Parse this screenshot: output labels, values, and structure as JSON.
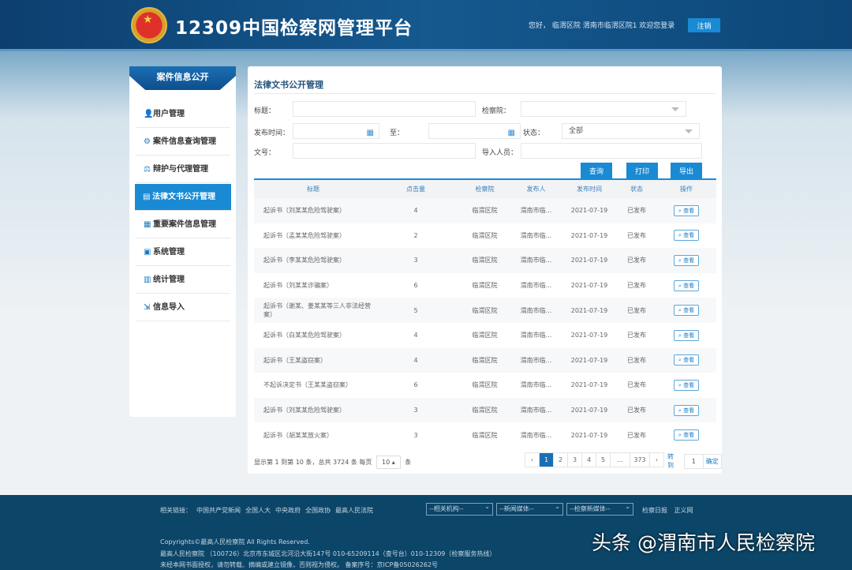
{
  "header": {
    "title": "12309中国检察网管理平台",
    "greeting": "您好， 临渭区院  渭南市临渭区院1  欢迎您登录",
    "logout": "注销"
  },
  "sidebar": {
    "title": "案件信息公开",
    "items": [
      {
        "label": "用户管理",
        "icon": "user-icon",
        "glyph": "👤"
      },
      {
        "label": "案件信息查询管理",
        "icon": "case-query-icon",
        "glyph": "⚙"
      },
      {
        "label": "辩护与代理管理",
        "icon": "defense-icon",
        "glyph": "⚖"
      },
      {
        "label": "法律文书公开管理",
        "icon": "book-icon",
        "glyph": "▤"
      },
      {
        "label": "重要案件信息管理",
        "icon": "important-case-icon",
        "glyph": "▦"
      },
      {
        "label": "系统管理",
        "icon": "system-icon",
        "glyph": "▣"
      },
      {
        "label": "统计管理",
        "icon": "stats-icon",
        "glyph": "▥"
      },
      {
        "label": "信息导入",
        "icon": "import-icon",
        "glyph": "⇲"
      }
    ],
    "active": 3
  },
  "main": {
    "title": "法律文书公开管理",
    "filters": {
      "title_label": "标题：",
      "procuratorate_label": "检察院：",
      "publish_time_label": "发布时间：",
      "to_label": "至：",
      "status_label": "状态：",
      "status_value": "全部",
      "doc_no_label": "文号：",
      "importer_label": "导入人员："
    },
    "buttons": {
      "query": "查询",
      "print": "打印",
      "export": "导出"
    },
    "columns": [
      "标题",
      "点击量",
      "检察院",
      "发布人",
      "发布时间",
      "状态",
      "操作"
    ],
    "view_label": "查看",
    "rows": [
      [
        "起诉书（刘某某危险驾驶案）",
        "4",
        "临渭区院",
        "渭南市临...",
        "2021-07-19",
        "已发布"
      ],
      [
        "起诉书（孟某某危险驾驶案）",
        "2",
        "临渭区院",
        "渭南市临...",
        "2021-07-19",
        "已发布"
      ],
      [
        "起诉书（李某某危险驾驶案）",
        "3",
        "临渭区院",
        "渭南市临...",
        "2021-07-19",
        "已发布"
      ],
      [
        "起诉书（刘某某诈骗案）",
        "6",
        "临渭区院",
        "渭南市临...",
        "2021-07-19",
        "已发布"
      ],
      [
        "起诉书（谢某、姜某某等三人非法经营案）",
        "5",
        "临渭区院",
        "渭南市临...",
        "2021-07-19",
        "已发布"
      ],
      [
        "起诉书（白某某危险驾驶案）",
        "4",
        "临渭区院",
        "渭南市临...",
        "2021-07-19",
        "已发布"
      ],
      [
        "起诉书（王某盗窃案）",
        "4",
        "临渭区院",
        "渭南市临...",
        "2021-07-19",
        "已发布"
      ],
      [
        "不起诉决定书（王某某盗窃案）",
        "6",
        "临渭区院",
        "渭南市临...",
        "2021-07-19",
        "已发布"
      ],
      [
        "起诉书（刘某某危险驾驶案）",
        "3",
        "临渭区院",
        "渭南市临...",
        "2021-07-19",
        "已发布"
      ],
      [
        "起诉书（胡某某放火案）",
        "3",
        "临渭区院",
        "渭南市临...",
        "2021-07-19",
        "已发布"
      ]
    ],
    "pagination": {
      "info_prefix": "显示第 1 到第 10 条，总共 3724 条 每页",
      "page_size": "10 ▴",
      "info_suffix": "条",
      "prev": "‹",
      "pages": [
        "1",
        "2",
        "3",
        "4",
        "5",
        "...",
        "373"
      ],
      "next": "›",
      "goto_label": "转到",
      "goto_value": "1",
      "confirm": "确定"
    }
  },
  "footer": {
    "links_label": "相关链接：",
    "links": [
      "中国共产党新闻",
      "全国人大",
      "中央政府",
      "全国政协",
      "最高人民法院"
    ],
    "selects": [
      "--相关机构--",
      "--新闻媒体--",
      "--检察新媒体--"
    ],
    "right_links": [
      "检察日报",
      "正义网"
    ],
    "copyright": "Copyrights©最高人民检察院 All Rights Reserved.",
    "address": "最高人民检察院 （100726）北京市东城区北河沿大街147号 010-65209114（查号台）010-12309（检察服务热线）",
    "notice": "未经本网书面授权，请勿转载、摘编或建立镜像，否则视为侵权。  备案序号：京ICP备05026262号"
  },
  "watermark": "头条 @渭南市人民检察院"
}
